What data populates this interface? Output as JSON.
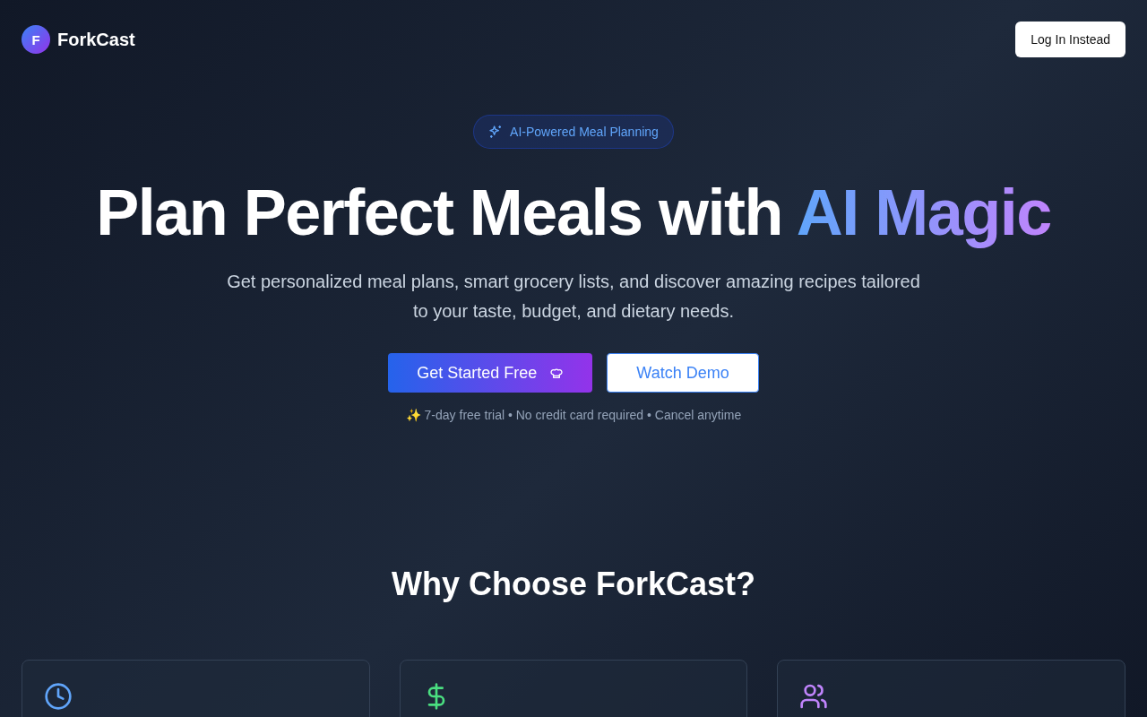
{
  "header": {
    "logo_letter": "F",
    "brand": "ForkCast",
    "login_button": "Log In Instead"
  },
  "hero": {
    "badge": "AI-Powered Meal Planning",
    "title": "Plan Perfect Meals with ",
    "title_highlight": "AI Magic",
    "subtitle": "Get personalized meal plans, smart grocery lists, and discover amazing recipes tailored to your taste, budget, and dietary needs.",
    "primary_button": "Get Started Free",
    "secondary_button": "Watch Demo",
    "note": "✨ 7-day free trial • No credit card required • Cancel anytime"
  },
  "features": {
    "heading": "Why Choose ForkCast?",
    "cards": [
      {
        "kind": "clock",
        "color": "#60a5fa"
      },
      {
        "kind": "dollar",
        "color": "#4ade80"
      },
      {
        "kind": "users",
        "color": "#c084fc"
      }
    ]
  }
}
